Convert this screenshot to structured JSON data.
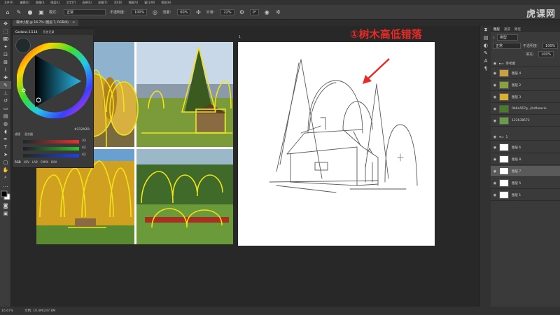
{
  "menubar": [
    "文件(F)",
    "编辑(E)",
    "图像(I)",
    "图层(L)",
    "文字(Y)",
    "选择(S)",
    "滤镜(T)",
    "3D(D)",
    "视图(V)",
    "窗口(W)",
    "帮助(H)"
  ],
  "options": {
    "mode_label": "模式：",
    "mode_value": "正常",
    "opacity_label": "不透明度：",
    "opacity_value": "100%",
    "flow_label": "流量：",
    "flow_value": "60%",
    "smooth_label": "平滑：",
    "smooth_value": "22%",
    "angle_value": "0°"
  },
  "logo": "虎课网",
  "document": {
    "tab_title": "森林小屋 @ 16.7% (图层 7, RGB/8)",
    "tab_close": "×",
    "label_sketch": "1",
    "label_ref": "1"
  },
  "annotation": {
    "title": "①树木高低错落",
    "arrow_color": "#e72a25"
  },
  "color_panel": {
    "tabs": [
      "Coolorus 2.5.14",
      "历史记录"
    ],
    "hex_readout": "#212A2D",
    "sub_tabs": [
      "滤镜",
      "混合器"
    ],
    "r_value": "33",
    "g_value": "42",
    "b_value": "42",
    "modes": [
      "RGB",
      "HSV",
      "LAB",
      "CMYK",
      "B/W"
    ]
  },
  "layers_panel": {
    "tabs": [
      "图层",
      "通道",
      "路径"
    ],
    "filter_label": "类型",
    "blend_mode": "正常",
    "opacity_label": "不透明度：",
    "opacity_value": "100%",
    "fill_label": "填充：",
    "fill_value": "100%",
    "rows": [
      {
        "name": "参考图",
        "type": "group"
      },
      {
        "name": "图层 4",
        "type": "layer"
      },
      {
        "name": "图层 2",
        "type": "layer"
      },
      {
        "name": "图层 3",
        "type": "layer"
      },
      {
        "name": "0b6a567g...Jhsfkeacie",
        "type": "layer"
      },
      {
        "name": "122638572",
        "type": "layer"
      },
      {
        "name": "1",
        "type": "group"
      },
      {
        "name": "图层 6",
        "type": "layer"
      },
      {
        "name": "图层 8",
        "type": "layer"
      },
      {
        "name": "图层 7",
        "type": "layer",
        "selected": true
      },
      {
        "name": "图层 5",
        "type": "layer"
      },
      {
        "name": "图层 1",
        "type": "layer"
      }
    ]
  },
  "status": {
    "zoom": "16.67%",
    "doc_info": "文档: 10.4M/247.8M"
  }
}
